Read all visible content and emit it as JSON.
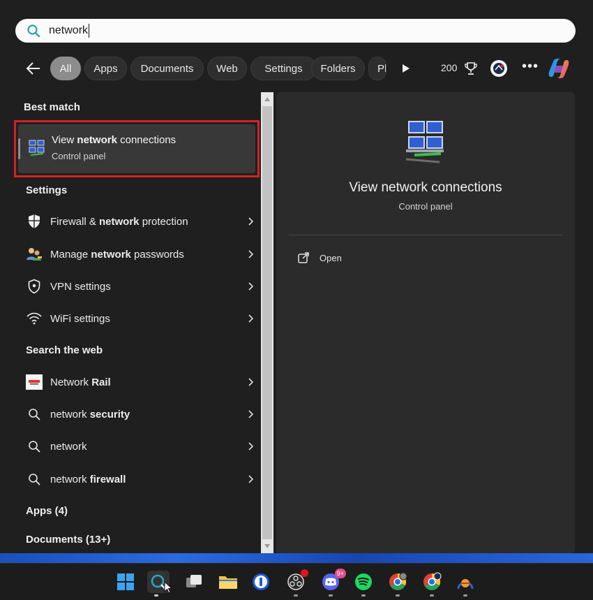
{
  "search": {
    "query": "network"
  },
  "filters": {
    "chips": [
      "All",
      "Apps",
      "Documents",
      "Web",
      "Settings",
      "Folders",
      "Ph"
    ],
    "active": "All",
    "points": "200"
  },
  "results": {
    "best_match_title": "Best match",
    "best_match": {
      "title_pre": "View ",
      "title_bold": "network",
      "title_post": " connections",
      "subtitle": "Control panel"
    },
    "settings_title": "Settings",
    "settings": [
      {
        "pre": "Firewall & ",
        "bold": "network",
        "post": " protection",
        "icon": "shield-filled-icon"
      },
      {
        "pre": "Manage ",
        "bold": "network",
        "post": " passwords",
        "icon": "users-key-icon"
      },
      {
        "pre": "VPN settings",
        "bold": "",
        "post": "",
        "icon": "shield-outline-icon"
      },
      {
        "pre": "WiFi settings",
        "bold": "",
        "post": "",
        "icon": "wifi-icon"
      }
    ],
    "web_title": "Search the web",
    "web": [
      {
        "pre": "Network ",
        "bold": "Rail",
        "post": "",
        "icon": "network-rail-logo"
      },
      {
        "pre": "network ",
        "bold": "security",
        "post": "",
        "icon": "search-icon"
      },
      {
        "pre": "network",
        "bold": "",
        "post": "",
        "icon": "search-icon"
      },
      {
        "pre": "network ",
        "bold": "firewall",
        "post": "",
        "icon": "search-icon"
      }
    ],
    "apps_title": "Apps (4)",
    "documents_title": "Documents (13+)"
  },
  "preview": {
    "title": "View network connections",
    "subtitle": "Control panel",
    "open_label": "Open"
  },
  "taskbar": {
    "discord_badge": "9+"
  },
  "colors": {
    "background": "#1f1f1f",
    "panel": "#2b2b2b",
    "highlight_border": "#d32222",
    "search_icon": "#2aa3a3"
  }
}
